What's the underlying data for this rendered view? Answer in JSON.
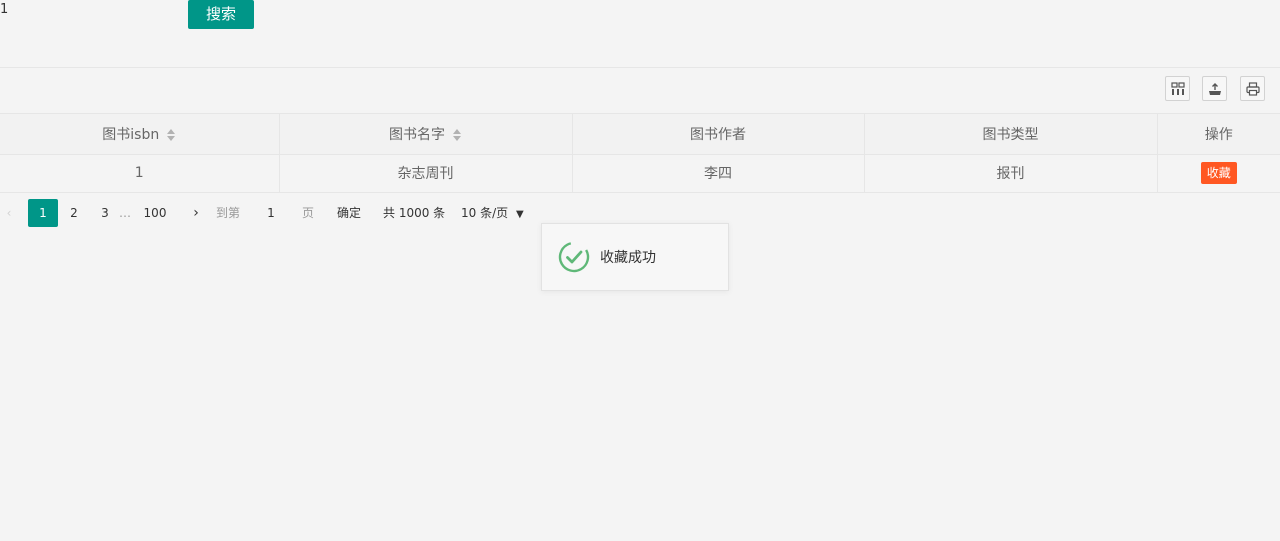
{
  "search": {
    "value": "1",
    "button_label": "搜索"
  },
  "toolbar": {
    "icons": [
      "columns-icon",
      "export-icon",
      "print-icon"
    ]
  },
  "table": {
    "headers": [
      "图书isbn",
      "图书名字",
      "图书作者",
      "图书类型",
      "操作"
    ],
    "rows": [
      {
        "isbn": "1",
        "name": "杂志周刊",
        "author": "李四",
        "type": "报刊",
        "action": "收藏"
      }
    ]
  },
  "pager": {
    "prev": "‹",
    "pages": [
      "1",
      "2",
      "3"
    ],
    "ellipsis": "…",
    "last": "100",
    "next": "›",
    "goto_label": "到第",
    "goto_value": "1",
    "page_suffix": "页",
    "confirm_label": "确定",
    "total_text": "共 1000 条",
    "page_size": "10 条/页",
    "page_size_caret": "▼"
  },
  "toast": {
    "message": "收藏成功"
  },
  "colors": {
    "primary": "#009688",
    "danger": "#ff5722",
    "success_icon": "#5fb878"
  }
}
